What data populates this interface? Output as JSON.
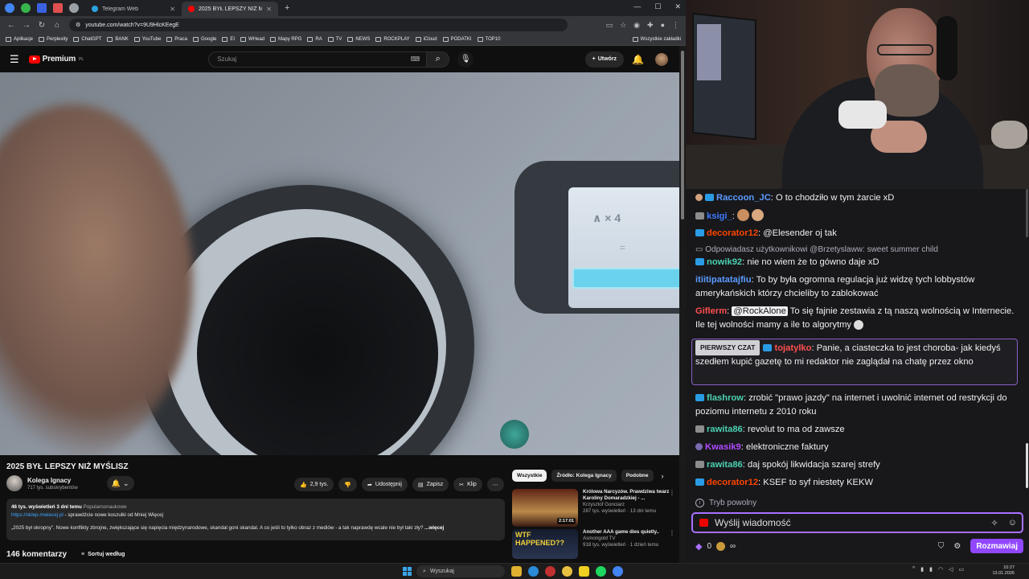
{
  "browser": {
    "tabs": [
      {
        "label": "Telegram Web",
        "color": "#2aa3e0",
        "active": false
      },
      {
        "label": "2025 BYŁ LEPSZY NIŻ MYŚLISZ",
        "color": "#ff0000",
        "active": true
      }
    ],
    "url": "youtube.com/watch?v=9U9HlcKEegE",
    "new_tab": "+",
    "bookmarks": [
      "Aplikacje",
      "Perplexity",
      "ChatGPT",
      "BANK",
      "YouTube",
      "Praca",
      "Google",
      "EI",
      "WHead",
      "Mapy RPG",
      "RA",
      "TV",
      "NEWS",
      "ROCKPLAY",
      "iCloud",
      "PODATKI",
      "TOP10"
    ],
    "all_bookmarks": "Wszystkie zakładki"
  },
  "youtube": {
    "logo": "Premium",
    "logo_sup": "PL",
    "search_placeholder": "Szukaj",
    "create_label": "Utwórz",
    "video_screen_digits": "∧ × 4",
    "video": {
      "title": "2025 BYŁ LEPSZY NIŻ MYŚLISZ",
      "channel": "Kolega Ignacy",
      "subs": "717 tys. subskrybentów",
      "likes": "2,9 tys.",
      "share": "Udostępnij",
      "save": "Zapisz",
      "clip": "Klip",
      "views": "46 tys. wyświetleń  3 dni temu",
      "tag": "Popularnonaukowe",
      "link": "https://sklep.mwiecej.pl",
      "link_text": " - sprawdźcie nowe koszulki od Mniej Więcej",
      "desc": "„2025 był okropny”. Nowe konflikty zbrojne, zwiększające się napięcia międzynarodowe, skandal goni skandal. A co jeśli to tylko obraz z mediów - a tak naprawdę wcale nie był taki zły?",
      "more": "...więcej",
      "comments": "146 komentarzy",
      "sort": "Sortuj według"
    },
    "chips": [
      "Wszystkie",
      "Źródło: Kolega Ignacy",
      "Podobne"
    ],
    "recs": [
      {
        "title": "Królowa Narcyzów. Prawdziwa twarz Karoliny Domaradzkiej - ...",
        "channel": "Krzysztof Gonciarz",
        "meta": "287 tys. wyświetleń · 13 dni temu",
        "dur": "2:17:01",
        "color1": "#6a2a1a",
        "color2": "#c9a066"
      },
      {
        "title": "Another AAA game dies quietly..",
        "channel": "Asmongold TV",
        "meta": "918 tys. wyświetleń · 1 dzień temu",
        "dur": "",
        "color1": "#1b2a44",
        "color2": "#e8c23a",
        "thumb_text": "WTF HAPPENED??"
      }
    ]
  },
  "twitch": {
    "messages": [
      {
        "user": "Raccoon_JC",
        "color": "#5b9bff",
        "text": ": O to chodziło w tym żarcie xD"
      },
      {
        "user": "ksigi_",
        "color": "#3d7bff",
        "text": ": "
      },
      {
        "user": "decorator12",
        "color": "#ff4500",
        "text": ": @Elesender oj tak"
      },
      {
        "reply": "Odpowiadasz użytkownikowi @Brzetyslaww: sweet summer child"
      },
      {
        "user": "nowik92",
        "color": "#4bd0b0",
        "text": ": nie no wiem że to gówno daje xD"
      },
      {
        "user": "itiitipatatajfiu",
        "color": "#5b9bff",
        "text": ": To by była ogromna regulacja już widzę tych lobbystów amerykańskich którzy chcieliby to zablokować"
      },
      {
        "user": "Giflerm",
        "color": "#ff4f4f",
        "mention": "@RockAlone",
        "text": " To się fajnie zestawia z tą naszą wolnością w Internecie. Ile tej wolności mamy a ile to algorytmy"
      },
      {
        "user": "tojatylko",
        "color": "#ff4f4f",
        "first": "PIERWSZY CZAT",
        "text": ": Panie, a ciasteczka to jest choroba- jak kiedyś szedłem kupić gazetę to mi redaktor nie zaglądał na chatę przez okno"
      },
      {
        "user": "flashrow",
        "color": "#4bd0b0",
        "text": ": zrobić \"prawo jazdy\" na internet i uwolnić internet od restrykcji do poziomu internetu z 2010 roku"
      },
      {
        "user": "rawita86",
        "color": "#4bd0b0",
        "text": ": revolut to ma od zawsze"
      },
      {
        "user": "Kwasik9",
        "color": "#b04bff",
        "text": ": elektroniczne faktury"
      },
      {
        "user": "rawita86",
        "color": "#4bd0b0",
        "text": ": daj spokój likwidacja szarej strefy"
      },
      {
        "user": "decorator12",
        "color": "#ff4500",
        "text": ": KSEF to syf niestety KEKW"
      }
    ],
    "slow_mode": "Tryb powolny",
    "input_placeholder": "Wyślij wiadomość",
    "points": "0",
    "chat_button": "Rozmawiaj"
  },
  "taskbar": {
    "search": "Wyszukaj",
    "time": "10:27",
    "date": "13.01.2026"
  }
}
